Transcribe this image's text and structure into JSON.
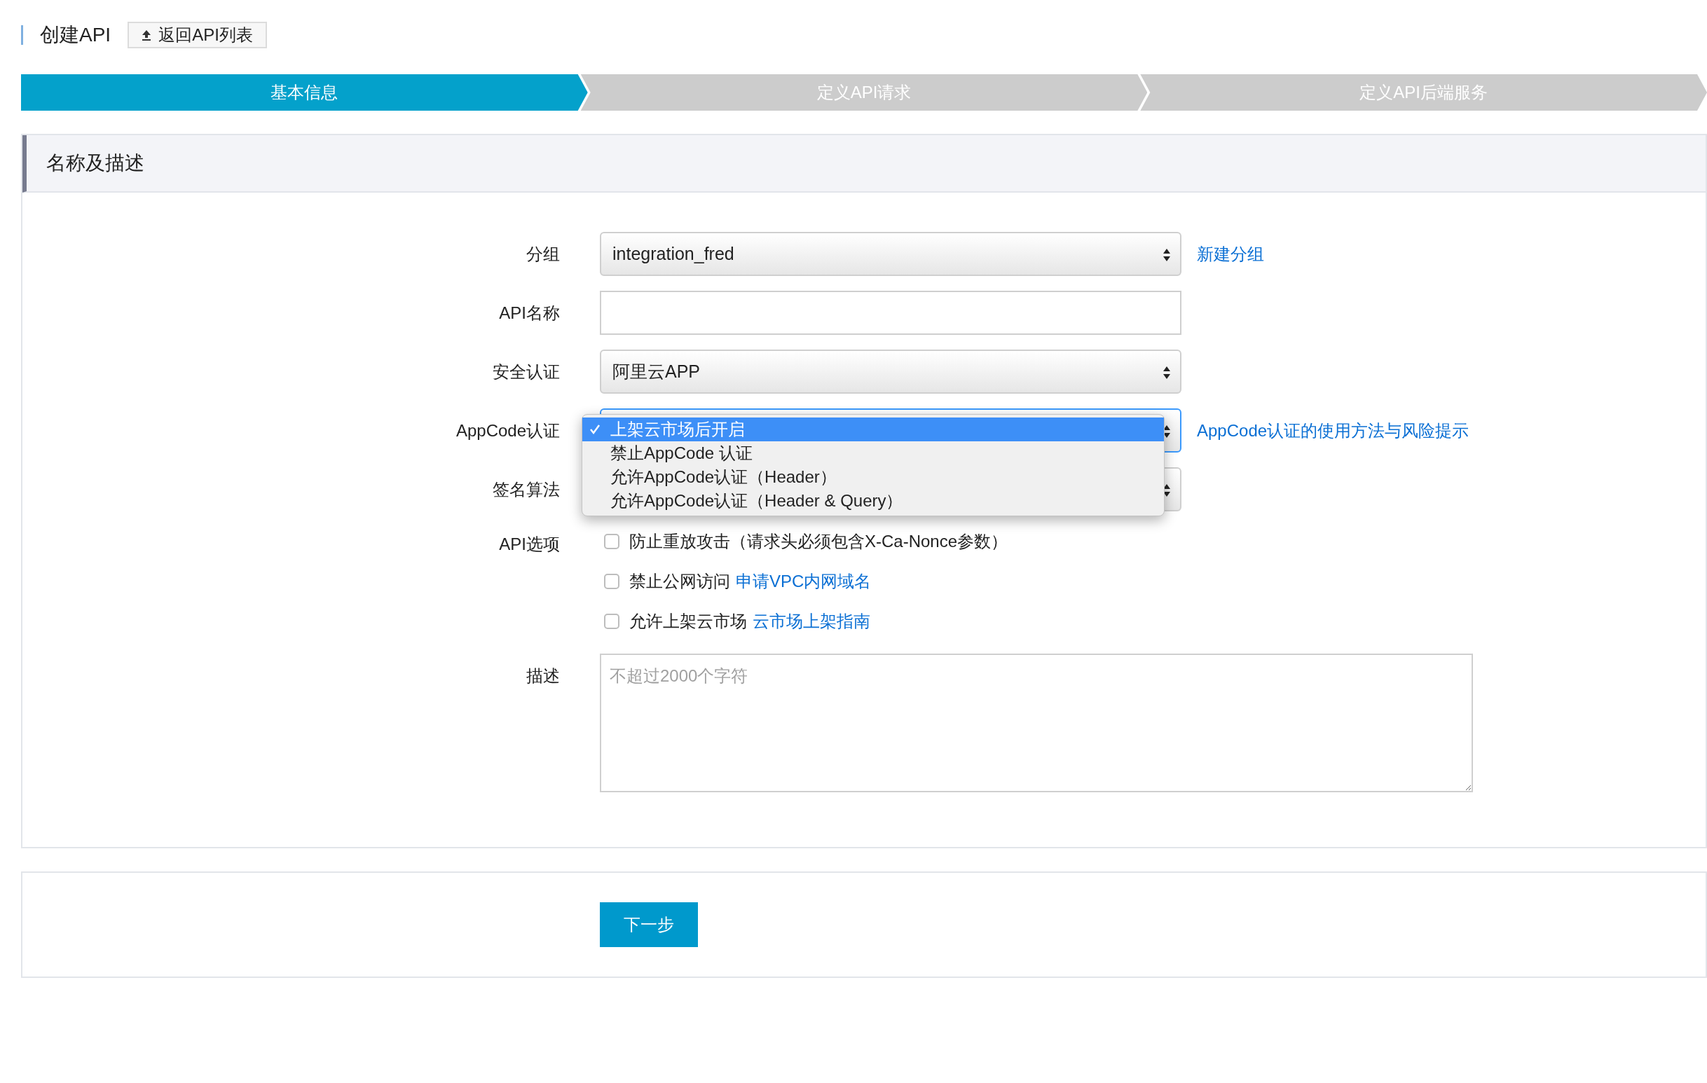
{
  "header": {
    "title": "创建API",
    "back_button": "返回API列表"
  },
  "steps": [
    {
      "label": "基本信息",
      "selected": true
    },
    {
      "label": "定义API请求",
      "selected": false
    },
    {
      "label": "定义API后端服务",
      "selected": false
    }
  ],
  "section_title": "名称及描述",
  "fields": [
    {
      "kind": "select",
      "label": "分组",
      "value": "integration_fred",
      "link": "新建分组"
    },
    {
      "kind": "text",
      "label": "API名称"
    },
    {
      "kind": "select",
      "label": "安全认证",
      "value": "阿里云APP"
    },
    {
      "kind": "open_select",
      "label": "AppCode认证",
      "link": "AppCode认证的使用方法与风险提示",
      "options": [
        {
          "label": "上架云市场后开启",
          "selected": true
        },
        {
          "label": "禁止AppCode 认证",
          "selected": false
        },
        {
          "label": "允许AppCode认证（Header）",
          "selected": false
        },
        {
          "label": "允许AppCode认证（Header & Query）",
          "selected": false
        }
      ]
    },
    {
      "kind": "select",
      "label": "签名算法"
    }
  ],
  "api_options": {
    "label": "API选项",
    "items": [
      {
        "text": "防止重放攻击（请求头必须包含X-Ca-Nonce参数）",
        "checked": false
      },
      {
        "text": "禁止公网访问",
        "link": "申请VPC内网域名",
        "checked": false
      },
      {
        "text": "允许上架云市场",
        "link": "云市场上架指南",
        "checked": false
      }
    ]
  },
  "description": {
    "label": "描述",
    "placeholder": "不超过2000个字符"
  },
  "next_button": "下一步"
}
